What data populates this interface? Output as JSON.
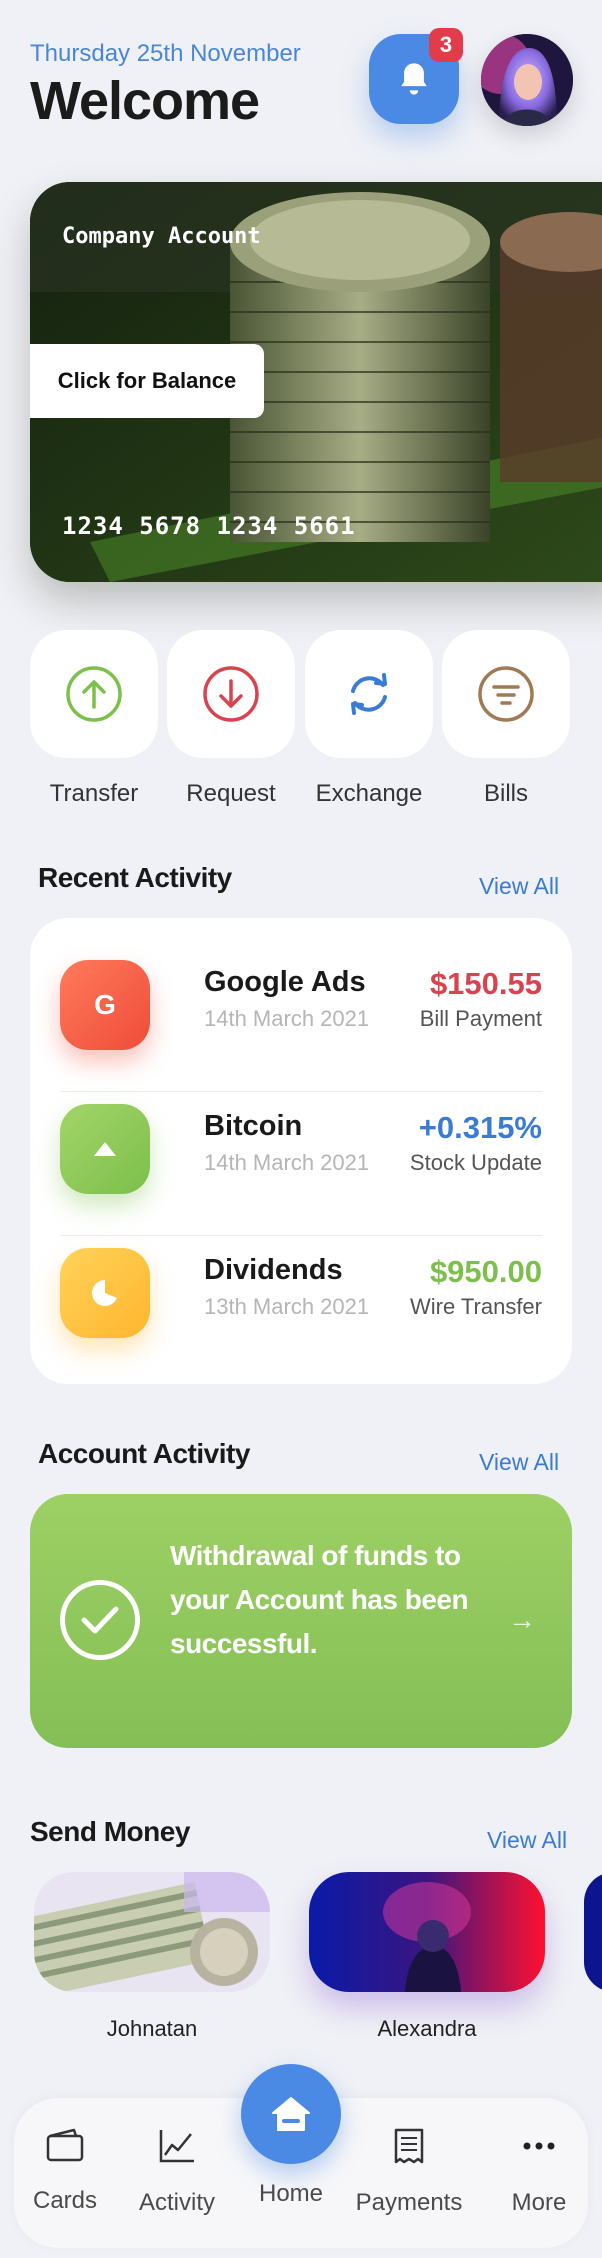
{
  "header": {
    "date": "Thursday 25th November",
    "title": "Welcome",
    "notification_count": "3"
  },
  "card": {
    "account_name": "Company Account",
    "balance_button": "Click for Balance",
    "number": "1234 5678 1234 5661"
  },
  "actions": [
    {
      "label": "Transfer",
      "icon": "arrow-up-circle-icon",
      "color": "#7cbf4a"
    },
    {
      "label": "Request",
      "icon": "arrow-down-circle-icon",
      "color": "#d9434f"
    },
    {
      "label": "Exchange",
      "icon": "refresh-icon",
      "color": "#3a7bd5"
    },
    {
      "label": "Bills",
      "icon": "filter-circle-icon",
      "color": "#a07a55"
    }
  ],
  "recent_activity": {
    "title": "Recent Activity",
    "view_all": "View All",
    "items": [
      {
        "name": "Google Ads",
        "date": "14th March 2021",
        "amount": "$150.55",
        "type": "Bill Payment",
        "icon": "google-icon",
        "amount_color": "#d9434f"
      },
      {
        "name": "Bitcoin",
        "date": "14th March 2021",
        "amount": "+0.315%",
        "type": "Stock Update",
        "icon": "triangle-up-icon",
        "amount_color": "#3a7bd5"
      },
      {
        "name": "Dividends",
        "date": "13th March 2021",
        "amount": "$950.00",
        "type": "Wire Transfer",
        "icon": "pie-chart-icon",
        "amount_color": "#7cbf4a"
      }
    ]
  },
  "account_activity": {
    "title": "Account Activity",
    "view_all": "View All",
    "message": "Withdrawal of funds to your Account has been successful."
  },
  "send_money": {
    "title": "Send Money",
    "view_all": "View All",
    "contacts": [
      {
        "name": "Johnatan"
      },
      {
        "name": "Alexandra"
      }
    ]
  },
  "bottom_nav": {
    "items": [
      {
        "label": "Cards",
        "icon": "wallet-icon"
      },
      {
        "label": "Activity",
        "icon": "chart-line-icon"
      },
      {
        "label": "Home",
        "icon": "home-icon"
      },
      {
        "label": "Payments",
        "icon": "receipt-icon"
      },
      {
        "label": "More",
        "icon": "more-dots-icon"
      }
    ]
  },
  "colors": {
    "accent_blue": "#4a8ae4",
    "success_green": "#8cc65a",
    "danger_red": "#d9434f",
    "background": "#f0f1f6"
  }
}
